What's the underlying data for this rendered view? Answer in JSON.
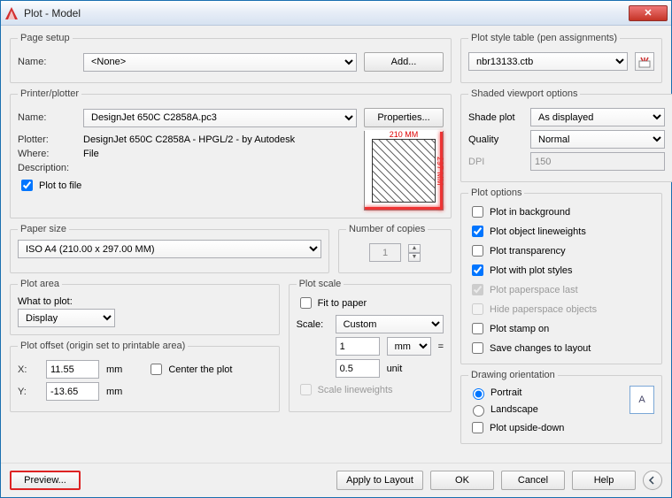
{
  "window": {
    "title": "Plot - Model"
  },
  "pageSetup": {
    "legend": "Page setup",
    "nameLabel": "Name:",
    "nameValue": "<None>",
    "addBtn": "Add..."
  },
  "plotStyleTable": {
    "legend": "Plot style table (pen assignments)",
    "value": "nbr13133.ctb"
  },
  "printer": {
    "legend": "Printer/plotter",
    "nameLabel": "Name:",
    "nameValue": "DesignJet 650C C2858A.pc3",
    "propertiesBtn": "Properties...",
    "plotterLabel": "Plotter:",
    "plotterValue": "DesignJet 650C C2858A - HPGL/2 - by Autodesk",
    "whereLabel": "Where:",
    "whereValue": "File",
    "descLabel": "Description:",
    "plotToFileLabel": "Plot to file",
    "preview": {
      "width": "210 MM",
      "height": "297 MM"
    }
  },
  "shadedViewport": {
    "legend": "Shaded viewport options",
    "shadePlotLabel": "Shade plot",
    "shadePlotValue": "As displayed",
    "qualityLabel": "Quality",
    "qualityValue": "Normal",
    "dpiLabel": "DPI",
    "dpiValue": "150"
  },
  "paperSize": {
    "legend": "Paper size",
    "value": "ISO A4 (210.00 x 297.00 MM)"
  },
  "copies": {
    "legend": "Number of copies",
    "value": "1"
  },
  "plotOptions": {
    "legend": "Plot options",
    "background": "Plot in background",
    "lineweights": "Plot object lineweights",
    "transparency": "Plot transparency",
    "withStyles": "Plot with plot styles",
    "paperspaceLast": "Plot paperspace last",
    "hidePaperspace": "Hide paperspace objects",
    "stampOn": "Plot stamp on",
    "saveChanges": "Save changes to layout"
  },
  "plotArea": {
    "legend": "Plot area",
    "whatLabel": "What to plot:",
    "whatValue": "Display"
  },
  "plotScale": {
    "legend": "Plot scale",
    "fitLabel": "Fit to paper",
    "scaleLabel": "Scale:",
    "scaleValue": "Custom",
    "num": "1",
    "unitSel": "mm",
    "eq": "=",
    "den": "0.5",
    "unitLbl": "unit",
    "scaleLW": "Scale lineweights"
  },
  "plotOffset": {
    "legend": "Plot offset (origin set to printable area)",
    "xLabel": "X:",
    "xValue": "11.55",
    "yLabel": "Y:",
    "yValue": "-13.65",
    "unit": "mm",
    "centerLabel": "Center the plot"
  },
  "orientation": {
    "legend": "Drawing orientation",
    "portrait": "Portrait",
    "landscape": "Landscape",
    "upsideDown": "Plot upside-down",
    "iconLetter": "A"
  },
  "footer": {
    "preview": "Preview...",
    "apply": "Apply to Layout",
    "ok": "OK",
    "cancel": "Cancel",
    "help": "Help"
  }
}
